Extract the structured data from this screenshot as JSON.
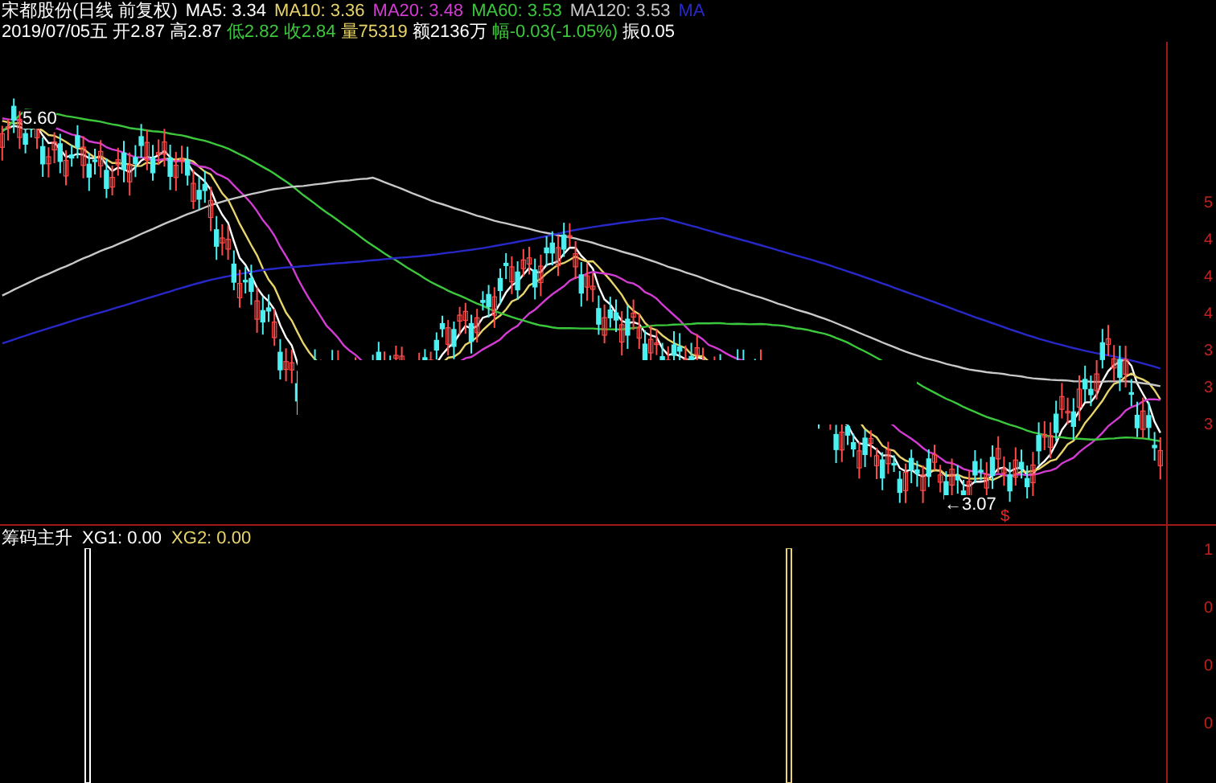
{
  "header": {
    "title": "宋都股份(日线 前复权)",
    "ma": [
      {
        "label": "MA5: 3.34",
        "color": "#ffffff"
      },
      {
        "label": "MA10: 3.36",
        "color": "#e8d46a"
      },
      {
        "label": "MA20: 3.48",
        "color": "#d23cd2"
      },
      {
        "label": "MA60: 3.53",
        "color": "#3cc83c"
      },
      {
        "label": "MA120: 3.53",
        "color": "#c8c8c8"
      },
      {
        "label": "MA",
        "color": "#2828c8"
      }
    ],
    "quote": [
      {
        "text": "2019/07/05五",
        "color": "#ffffff"
      },
      {
        "text": "开2.87",
        "color": "#ffffff"
      },
      {
        "text": "高2.87",
        "color": "#ffffff"
      },
      {
        "text": "低2.82",
        "color": "#3cc83c"
      },
      {
        "text": "收2.84",
        "color": "#3cc83c"
      },
      {
        "text": "量75319",
        "color": "#e8d46a"
      },
      {
        "text": "额2136万",
        "color": "#ffffff"
      },
      {
        "text": "幅-0.03(-1.05%)",
        "color": "#3cc83c"
      },
      {
        "text": "振0.05",
        "color": "#ffffff"
      }
    ]
  },
  "price_chart": {
    "high_label": "5.60",
    "low_label": "←3.07",
    "marker": "$",
    "axis_labels": [
      "5",
      "4",
      "4",
      "4",
      "3",
      "3",
      "3"
    ]
  },
  "indicator": {
    "title": "筹码主升",
    "values": [
      {
        "label": "XG1: 0.00",
        "color": "#ffffff"
      },
      {
        "label": "XG2: 0.00",
        "color": "#e8d46a"
      }
    ],
    "axis_labels": [
      "1",
      "0",
      "0",
      "0"
    ]
  }
}
